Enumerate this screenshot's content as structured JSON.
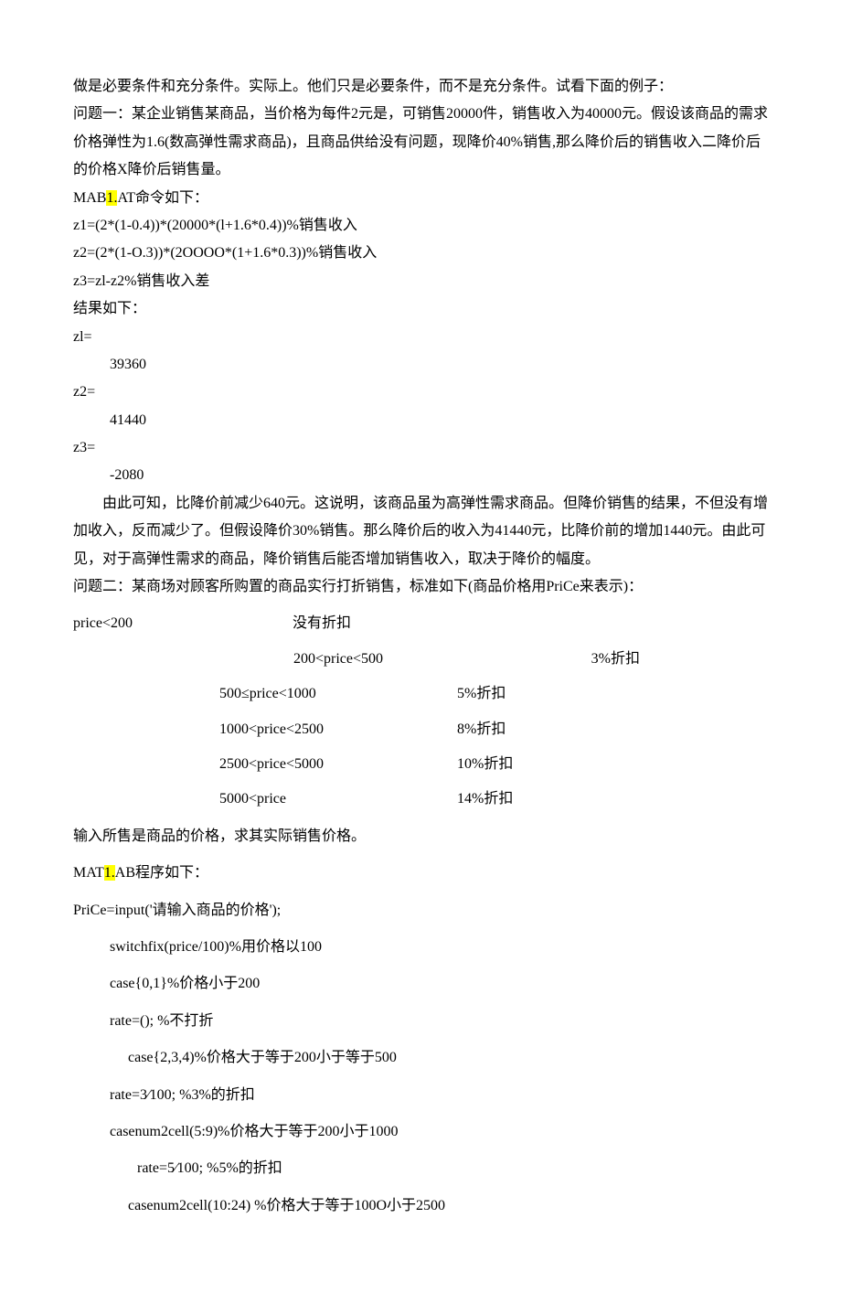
{
  "p1": "做是必要条件和充分条件。实际上。他们只是必要条件，而不是充分条件。试看下面的例子：",
  "p2": "问题一：某企业销售某商品，当价格为每件2元是，可销售20000件，销售收入为40000元。假设该商品的需求价格弹性为1.6(数高弹性需求商品)，且商品供给没有问题，现降价40%销售,那么降价后的销售收入二降价后的价格X降价后销售量。",
  "p3a": "MAB",
  "p3hl": "1.",
  "p3b": "AT命令如下：",
  "p4": "z1=(2*(1-0.4))*(20000*(l+1.6*0.4))%销售收入",
  "p5": "z2=(2*(1-O.3))*(2OOOO*(1+1.6*0.3))%销售收入",
  "p6": "z3=zl-z2%销售收入差",
  "p7": "结果如下：",
  "p8": "zl=",
  "p9": "39360",
  "p10": "z2=",
  "p11": "41440",
  "p12": "z3=",
  "p13": "-2080",
  "p14": "由此可知，比降价前减少640元。这说明，该商品虽为高弹性需求商品。但降价销售的结果，不但没有增加收入，反而减少了。但假设降价30%销售。那么降价后的收入为41440元，比降价前的增加1440元。由此可见，对于高弹性需求的商品，降价销售后能否增加销售收入，取决于降价的幅度。",
  "p15": "问题二：某商场对顾客所购置的商品实行打折销售，标准如下(商品价格用PriCe来表示)：",
  "table": {
    "r0": {
      "a": "price<200",
      "b": "没有折扣"
    },
    "r1": {
      "a": "200<price<500",
      "b": "3%折扣"
    },
    "r2": {
      "a": "500≤price<1000",
      "b": "5%折扣"
    },
    "r3": {
      "a": "1000<price<2500",
      "b": "8%折扣"
    },
    "r4": {
      "a": "2500<price<5000",
      "b": "10%折扣"
    },
    "r5": {
      "a": "5000<price",
      "b": "14%折扣"
    }
  },
  "p16": "输入所售是商品的价格，求其实际销售价格。",
  "p17a": "MAT",
  "p17hl": "1.",
  "p17b": "AB程序如下：",
  "p18": "PriCe=input('请输入商品的价格');",
  "p19": "switchfix(price/100)%用价格以100",
  "p20": "case{0,1}%价格小于200",
  "p21": "rate=();      %不打折",
  "p22": "case{2,3,4)%价格大于等于200小于等于500",
  "p23": "rate=3⁄100;               %3%的折扣",
  "p24": "casenum2cell(5:9)%价格大于等于200小于1000",
  "p25": "rate=5⁄100;                 %5%的折扣",
  "p26": "casenum2cell(10:24)                   %价格大于等于100O小于2500"
}
